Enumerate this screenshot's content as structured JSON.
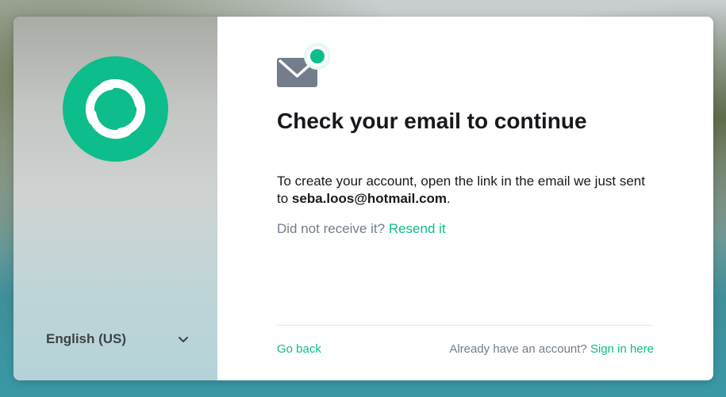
{
  "sidebar": {
    "language_label": "English (US)",
    "logo_icon": "element-logo-icon",
    "dropdown_icon": "chevron-down-icon"
  },
  "main": {
    "icon": "envelope-notification-icon",
    "title": "Check your email to continue",
    "message_prefix": "To create your account, open the link in the email we just sent to ",
    "email": "seba.loos@hotmail.com",
    "message_suffix": ".",
    "resend_prompt": "Did not receive it?",
    "resend_link": "Resend it"
  },
  "footer": {
    "go_back": "Go back",
    "signin_prompt": "Already have an account?",
    "signin_link": "Sign in here"
  },
  "colors": {
    "accent": "#0dbd8b",
    "text_primary": "#17191c",
    "text_secondary": "#737d8c",
    "divider": "#e3e8f0",
    "envelope": "#737d8c"
  }
}
